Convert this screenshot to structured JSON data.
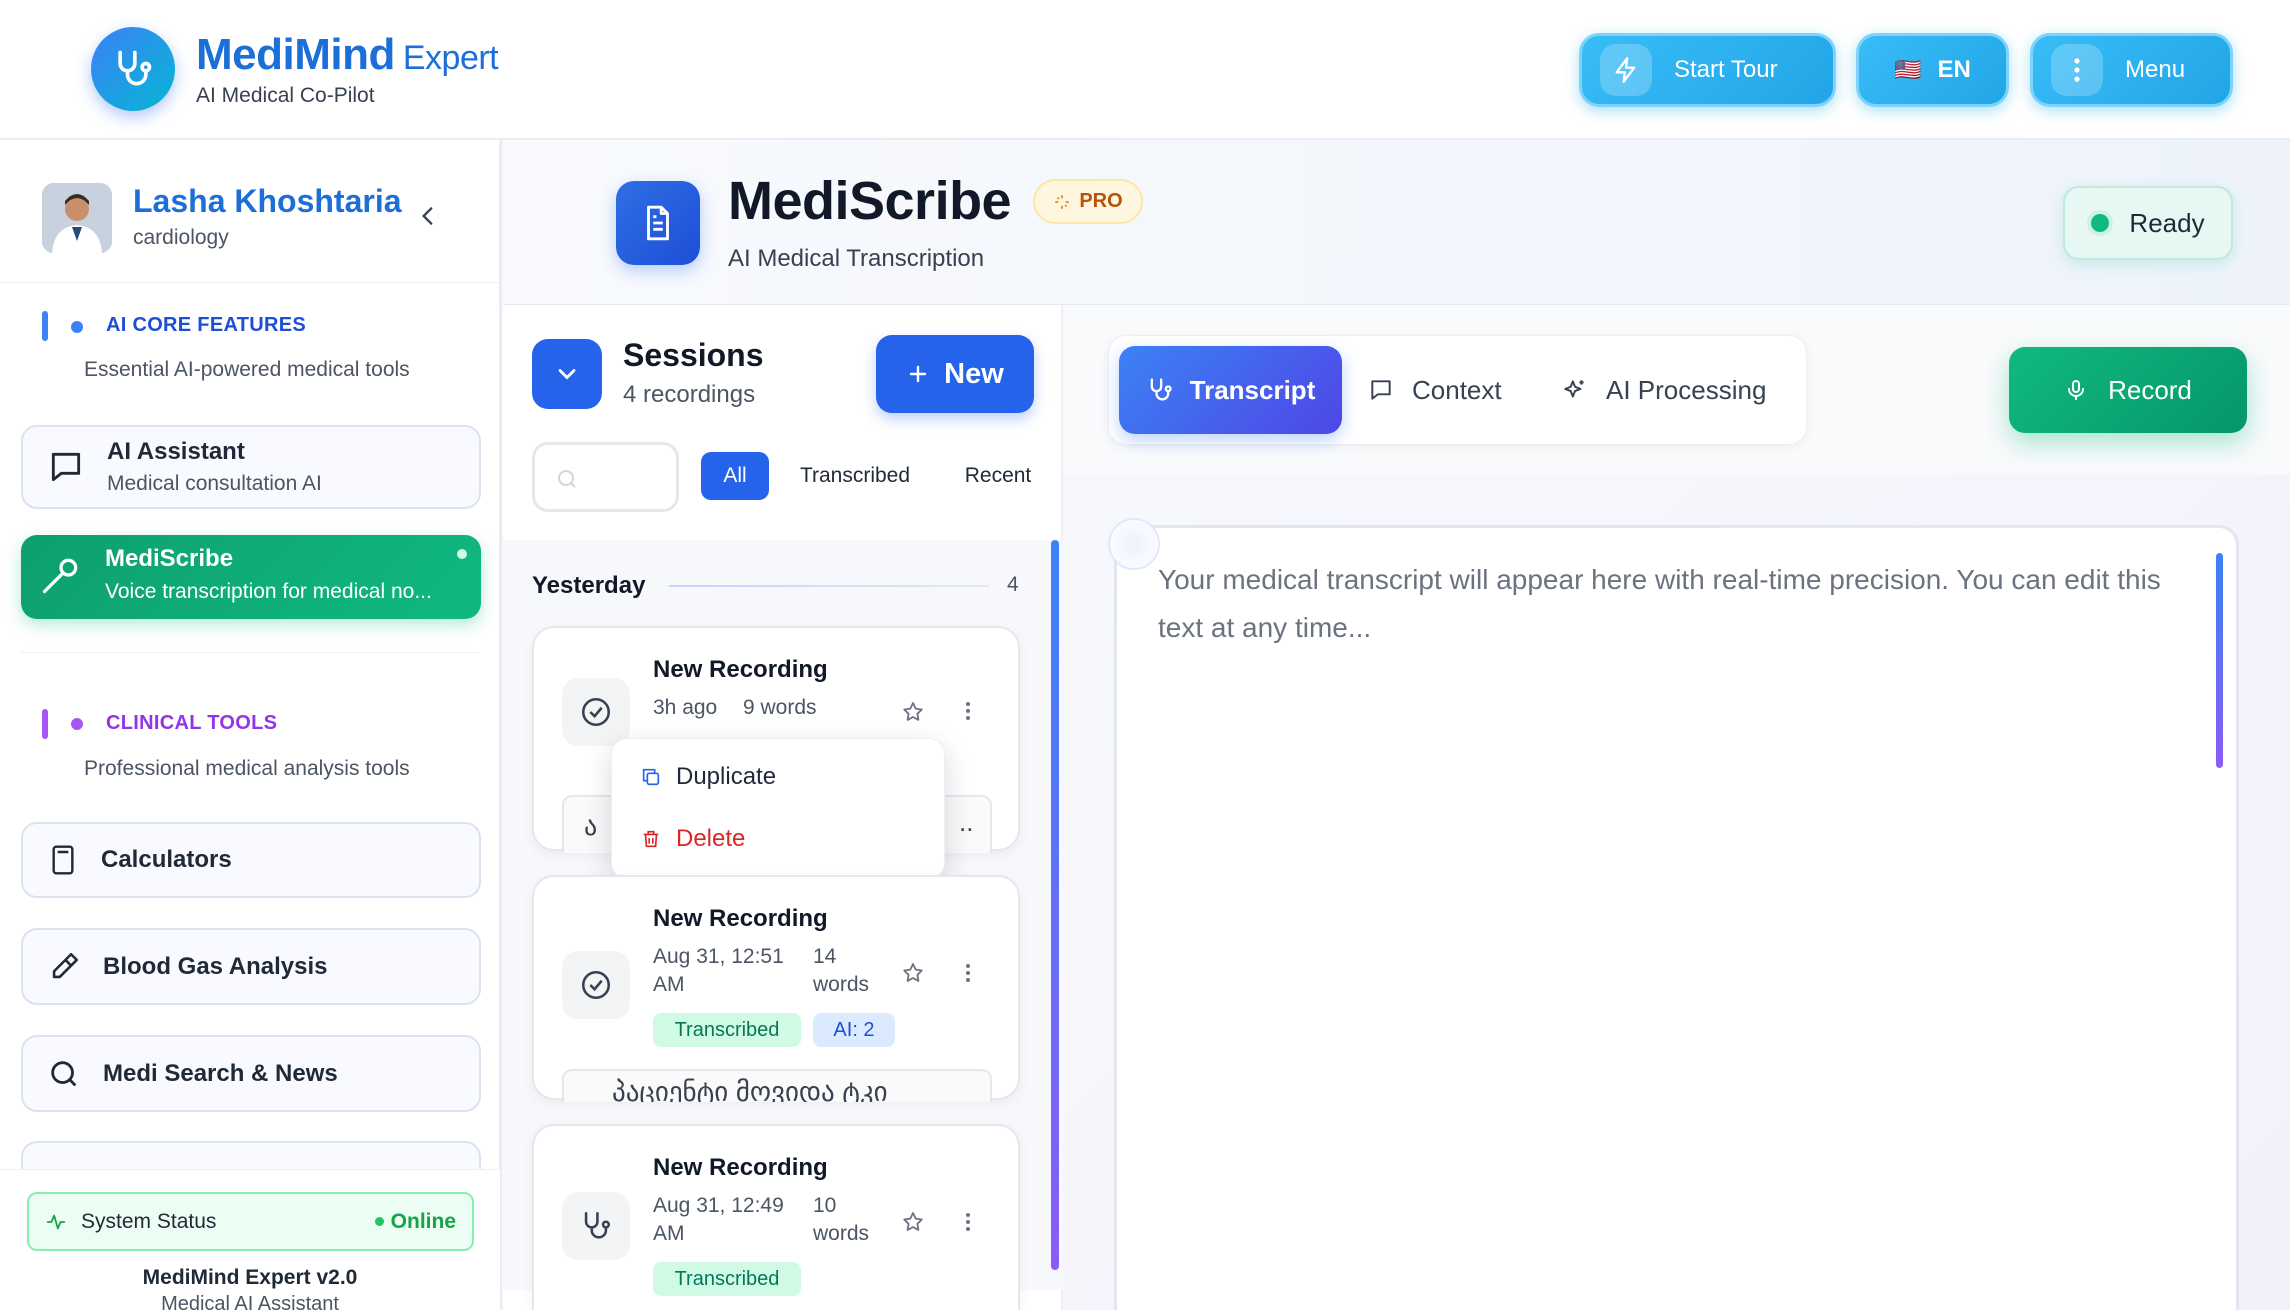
{
  "header": {
    "brand_name": "MediMind",
    "brand_suffix": "Expert",
    "tagline": "AI Medical Co-Pilot",
    "start_tour_label": "Start Tour",
    "language_flag": "🇺🇸",
    "language_code": "EN",
    "menu_label": "Menu"
  },
  "user": {
    "name": "Lasha Khoshtaria",
    "specialty": "cardiology"
  },
  "sidebar": {
    "sections": [
      {
        "title": "AI CORE FEATURES",
        "description": "Essential AI-powered medical tools",
        "color": "#2563eb"
      },
      {
        "title": "CLINICAL TOOLS",
        "description": "Professional medical analysis tools",
        "color": "#9333ea"
      }
    ],
    "ai_items": [
      {
        "title": "AI Assistant",
        "subtitle": "Medical consultation AI"
      },
      {
        "title": "MediScribe",
        "subtitle": "Voice transcription for medical no..."
      }
    ],
    "clinical_items": [
      {
        "title": "Calculators"
      },
      {
        "title": "Blood Gas Analysis"
      },
      {
        "title": "Medi Search & News"
      }
    ],
    "status_label": "System Status",
    "status_value": "Online",
    "version": "MediMind Expert v2.0",
    "version_sub": "Medical AI Assistant"
  },
  "page": {
    "title": "MediScribe",
    "badge": "PRO",
    "subtitle": "AI Medical Transcription",
    "status": "Ready"
  },
  "sessions": {
    "title": "Sessions",
    "count_text": "4 recordings",
    "new_label": "New",
    "search_placeholder": "",
    "filters": [
      "All",
      "Transcribed",
      "Recent"
    ],
    "active_filter": "All",
    "group_label": "Yesterday",
    "group_count": "4",
    "items": [
      {
        "title": "New Recording",
        "time": "3h ago",
        "words": "9 words",
        "preview": "ა",
        "preview_end": ".."
      },
      {
        "title": "New Recording",
        "time_line1": "Aug 31, 12:51",
        "time_line2": "AM",
        "words_line1": "14",
        "words_line2": "words",
        "status_tag": "Transcribed",
        "ai_tag": "AI: 2",
        "preview": "პაციენტი მოვიდა ტკი"
      },
      {
        "title": "New Recording",
        "time_line1": "Aug 31, 12:49",
        "time_line2": "AM",
        "words_line1": "10",
        "words_line2": "words",
        "status_tag": "Transcribed"
      }
    ],
    "menu": {
      "duplicate": "Duplicate",
      "delete": "Delete"
    }
  },
  "tabs": {
    "transcript": "Transcript",
    "context": "Context",
    "ai_processing": "AI Processing",
    "record": "Record"
  },
  "editor": {
    "placeholder": "Your medical transcript will appear here with real-time precision. You can edit this text at any time..."
  }
}
